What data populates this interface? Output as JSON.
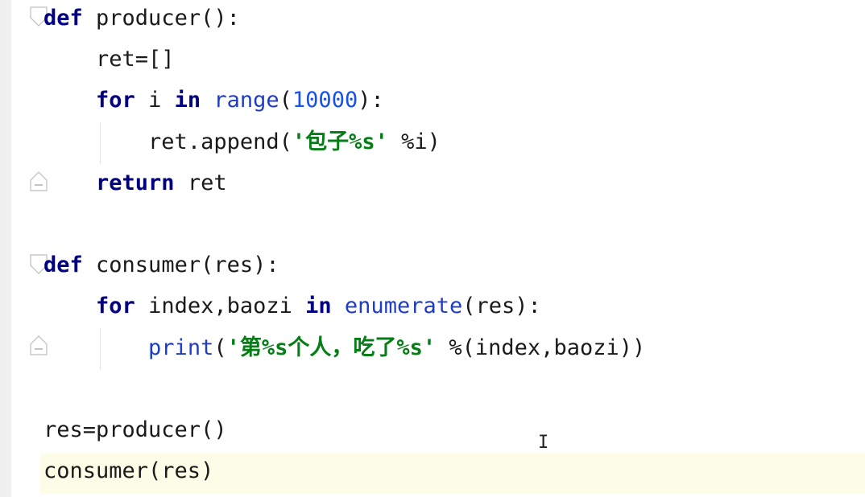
{
  "editor": {
    "lines": [
      {
        "indent": "",
        "tokens": [
          {
            "t": "kw",
            "v": "def"
          },
          {
            "t": "plain",
            "v": " producer():"
          }
        ]
      },
      {
        "indent": "    ",
        "tokens": [
          {
            "t": "plain",
            "v": "ret=[]"
          }
        ]
      },
      {
        "indent": "    ",
        "tokens": [
          {
            "t": "kw",
            "v": "for"
          },
          {
            "t": "plain",
            "v": " i "
          },
          {
            "t": "kw",
            "v": "in"
          },
          {
            "t": "plain",
            "v": " "
          },
          {
            "t": "fn",
            "v": "range"
          },
          {
            "t": "plain",
            "v": "("
          },
          {
            "t": "num",
            "v": "10000"
          },
          {
            "t": "plain",
            "v": "):"
          }
        ]
      },
      {
        "indent": "        ",
        "tokens": [
          {
            "t": "plain",
            "v": "ret.append("
          },
          {
            "t": "str",
            "v": "'包子%s'"
          },
          {
            "t": "plain",
            "v": " %i)"
          }
        ]
      },
      {
        "indent": "    ",
        "tokens": [
          {
            "t": "kw",
            "v": "return"
          },
          {
            "t": "plain",
            "v": " ret"
          }
        ]
      },
      {
        "indent": "",
        "tokens": []
      },
      {
        "indent": "",
        "tokens": [
          {
            "t": "kw",
            "v": "def"
          },
          {
            "t": "plain",
            "v": " consumer(res):"
          }
        ]
      },
      {
        "indent": "    ",
        "tokens": [
          {
            "t": "kw",
            "v": "for"
          },
          {
            "t": "plain",
            "v": " index,baozi "
          },
          {
            "t": "kw",
            "v": "in"
          },
          {
            "t": "plain",
            "v": " "
          },
          {
            "t": "fn",
            "v": "enumerate"
          },
          {
            "t": "plain",
            "v": "(res):"
          }
        ]
      },
      {
        "indent": "        ",
        "tokens": [
          {
            "t": "fn",
            "v": "print"
          },
          {
            "t": "plain",
            "v": "("
          },
          {
            "t": "str",
            "v": "'第%s个人，吃了%s'"
          },
          {
            "t": "plain",
            "v": " %(index,baozi))"
          }
        ]
      },
      {
        "indent": "",
        "tokens": []
      },
      {
        "indent": "",
        "tokens": [
          {
            "t": "plain",
            "v": "res=producer()"
          }
        ]
      },
      {
        "indent": "",
        "tokens": [
          {
            "t": "plain",
            "v": "consumer(res)"
          }
        ],
        "current": true
      }
    ],
    "fold_markers": [
      "fold-start",
      "fold-end",
      "fold-start",
      "fold-end"
    ],
    "colors": {
      "keyword": "#000080",
      "builtin": "#1f3dc4",
      "number": "#1750eb",
      "string": "#067d17",
      "current_line": "#fdfde7"
    },
    "cursor_icon": "text-cursor-icon"
  }
}
